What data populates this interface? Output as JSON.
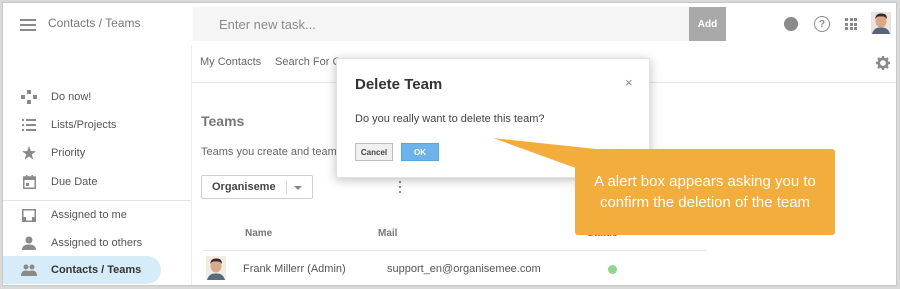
{
  "header": {
    "breadcrumb": "Contacts / Teams",
    "task_placeholder": "Enter new task...",
    "add_label": "Add",
    "help_glyph": "?"
  },
  "sidebar": {
    "items": [
      {
        "label": "Do now!",
        "icon": "gamepad-icon"
      },
      {
        "label": "Lists/Projects",
        "icon": "list-icon"
      },
      {
        "label": "Priority",
        "icon": "star-icon"
      },
      {
        "label": "Due Date",
        "icon": "calendar-icon"
      },
      {
        "label": "Assigned to me",
        "icon": "inbox-icon"
      },
      {
        "label": "Assigned to others",
        "icon": "person-icon"
      },
      {
        "label": "Contacts / Teams",
        "icon": "people-icon",
        "active": true
      }
    ]
  },
  "main": {
    "tabs": [
      {
        "label": "My Contacts"
      },
      {
        "label": "Search For C"
      }
    ],
    "heading": "Teams",
    "description": "Teams you create and teams y",
    "team_select": {
      "value": "Organiseme"
    },
    "table": {
      "columns": [
        "Name",
        "Mail",
        "Status"
      ],
      "rows": [
        {
          "name": "Frank Millerr (Admin)",
          "mail": "support_en@organisemee.com",
          "status": "active"
        }
      ]
    }
  },
  "dialog": {
    "title": "Delete Team",
    "close_glyph": "×",
    "message": "Do you really want to delete this team?",
    "cancel_label": "Cancel",
    "ok_label": "OK"
  },
  "callout": {
    "line1": "A alert box appears asking you to",
    "line2": "confirm the deletion of the team"
  },
  "colors": {
    "accent": "#f3ad3c",
    "ok_button": "#6bb3ea",
    "active_nav": "#d6ecf9",
    "status_green": "#8fd48f"
  }
}
